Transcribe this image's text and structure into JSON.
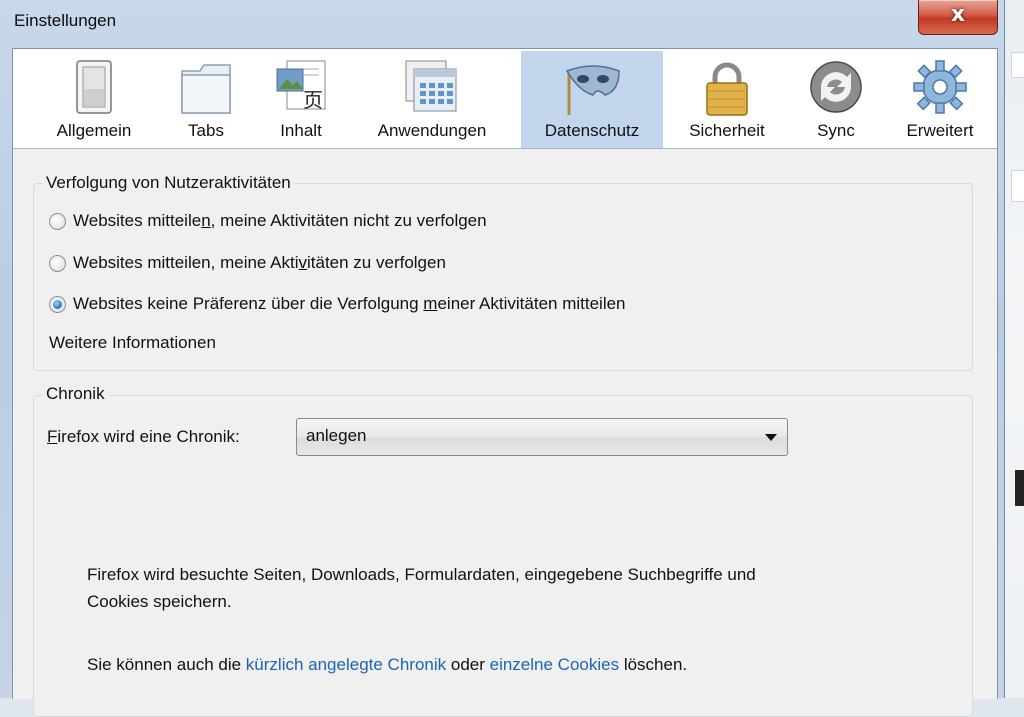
{
  "window": {
    "title": "Einstellungen",
    "close_glyph": "x"
  },
  "toolbar": {
    "items": [
      {
        "label": "Allgemein",
        "icon": "switch-icon"
      },
      {
        "label": "Tabs",
        "icon": "tabs-folder-icon"
      },
      {
        "label": "Inhalt",
        "icon": "content-page-icon"
      },
      {
        "label": "Anwendungen",
        "icon": "applications-window-icon"
      },
      {
        "label": "Datenschutz",
        "icon": "privacy-mask-icon",
        "selected": true
      },
      {
        "label": "Sicherheit",
        "icon": "padlock-icon"
      },
      {
        "label": "Sync",
        "icon": "sync-arrows-icon"
      },
      {
        "label": "Erweitert",
        "icon": "gear-icon"
      }
    ]
  },
  "tracking": {
    "group_label": "Verfolgung von Nutzeraktivitäten",
    "options": [
      {
        "pre": "Websites mitteile",
        "accesskey": "n",
        "post": ", meine Aktivitäten nicht zu verfolgen",
        "checked": false
      },
      {
        "pre": "Websites mitteilen, meine Akti",
        "accesskey": "v",
        "post": "itäten zu verfolgen",
        "checked": false
      },
      {
        "pre": "Websites keine Präferenz über die Verfolgung ",
        "accesskey": "m",
        "post": "einer Aktivitäten mitteilen",
        "checked": true
      }
    ],
    "more_info_link": "Weitere Informationen"
  },
  "history": {
    "group_label": "Chronik",
    "label_accesskey": "F",
    "label_rest": "irefox wird eine Chronik:",
    "select_value": "anlegen",
    "description_line1": "Firefox wird besuchte Seiten, Downloads, Formulardaten, eingegebene Suchbegriffe und",
    "description_line2": "Cookies speichern.",
    "clear_prefix": "Sie können auch die ",
    "clear_link1": "kürzlich angelegte Chronik",
    "clear_middle": " oder ",
    "clear_link2": "einzelne Cookies",
    "clear_suffix": " löschen."
  }
}
